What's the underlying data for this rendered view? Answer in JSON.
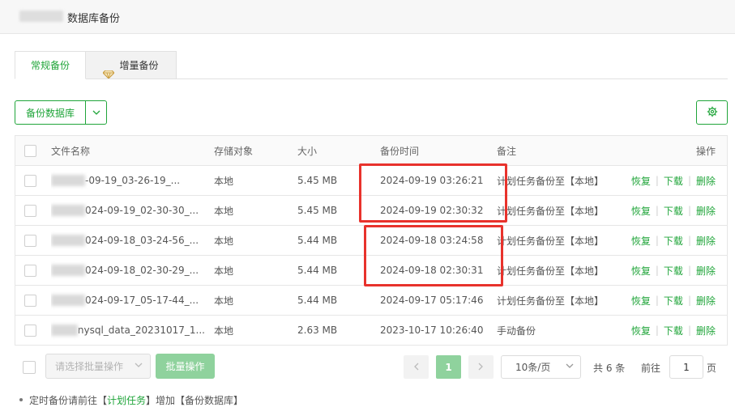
{
  "header": {
    "title": "数据库备份"
  },
  "tabs": [
    {
      "label": "常规备份",
      "active": true
    },
    {
      "label": "增量备份",
      "active": false,
      "icon": "diamond-icon"
    }
  ],
  "toolbar": {
    "backup_label": "备份数据库",
    "settings_icon": "gear-icon"
  },
  "table": {
    "columns": [
      "文件名称",
      "存储对象",
      "大小",
      "备份时间",
      "备注",
      "操作"
    ],
    "rows": [
      {
        "name": "-09-19_03-26-19_...",
        "storage": "本地",
        "size": "5.45 MB",
        "time": "2024-09-19 03:26:21",
        "note": "计划任务备份至【本地】"
      },
      {
        "name": "024-09-19_02-30-30_...",
        "storage": "本地",
        "size": "5.45 MB",
        "time": "2024-09-19 02:30:32",
        "note": "计划任务备份至【本地】"
      },
      {
        "name": "024-09-18_03-24-56_...",
        "storage": "本地",
        "size": "5.44 MB",
        "time": "2024-09-18 03:24:58",
        "note": "计划任务备份至【本地】"
      },
      {
        "name": "024-09-18_02-30-29_...",
        "storage": "本地",
        "size": "5.44 MB",
        "time": "2024-09-18 02:30:31",
        "note": "计划任务备份至【本地】"
      },
      {
        "name": "024-09-17_05-17-44_...",
        "storage": "本地",
        "size": "5.44 MB",
        "time": "2024-09-17 05:17:46",
        "note": "计划任务备份至【本地】"
      },
      {
        "name": "nysql_data_20231017_1...",
        "storage": "本地",
        "size": "2.63 MB",
        "time": "2023-10-17 10:26:40",
        "note": "手动备份"
      }
    ],
    "actions": {
      "restore": "恢复",
      "download": "下载",
      "delete": "删除"
    }
  },
  "footer": {
    "batch_placeholder": "请选择批量操作",
    "batch_button": "批量操作",
    "prev": "<",
    "page": "1",
    "next": ">",
    "page_size": "10条/页",
    "total": "共 6 条",
    "goto_label": "前往",
    "goto_value": "1",
    "page_unit": "页"
  },
  "hint": {
    "prefix": "定时备份请前往【",
    "link": "计划任务",
    "suffix": "】增加【备份数据库】"
  },
  "colors": {
    "accent": "#20a53a",
    "highlight": "#e8322c"
  }
}
